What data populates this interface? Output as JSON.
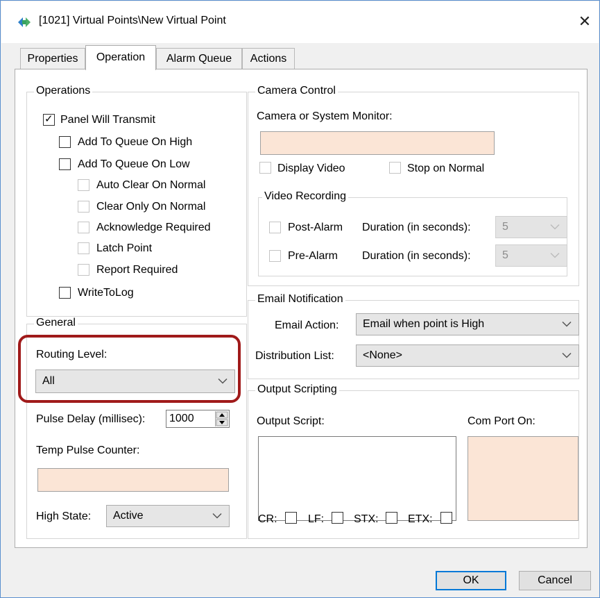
{
  "window": {
    "title": "[1021] Virtual Points\\New Virtual Point",
    "close_glyph": "✕",
    "icon": "refresh-arrows-icon"
  },
  "tabs": [
    {
      "label": "Properties",
      "active": false
    },
    {
      "label": "Operation",
      "active": true
    },
    {
      "label": "Alarm Queue",
      "active": false
    },
    {
      "label": "Actions",
      "active": false
    }
  ],
  "operations": {
    "legend": "Operations",
    "panel_will_transmit": {
      "label": "Panel Will Transmit",
      "checked": true
    },
    "add_queue_high": {
      "label": "Add To Queue On High",
      "checked": false
    },
    "add_queue_low": {
      "label": "Add To Queue On Low",
      "checked": false
    },
    "auto_clear": {
      "label": "Auto Clear On Normal",
      "checked": false,
      "enabled": false
    },
    "clear_only": {
      "label": "Clear Only On Normal",
      "checked": false,
      "enabled": false
    },
    "ack_required": {
      "label": "Acknowledge Required",
      "checked": false,
      "enabled": false
    },
    "latch_point": {
      "label": "Latch Point",
      "checked": false,
      "enabled": false
    },
    "report_required": {
      "label": "Report Required",
      "checked": false,
      "enabled": false
    },
    "write_to_log": {
      "label": "WriteToLog",
      "checked": false
    }
  },
  "general": {
    "legend": "General",
    "routing_label": "Routing Level:",
    "routing_value": "All",
    "pulse_label": "Pulse Delay (millisec):",
    "pulse_value": "1000",
    "temp_pulse_label": "Temp Pulse Counter:",
    "temp_pulse_value": "",
    "high_state_label": "High State:",
    "high_state_value": "Active"
  },
  "camera": {
    "legend": "Camera Control",
    "monitor_label": "Camera or System Monitor:",
    "monitor_value": "",
    "display_video": "Display Video",
    "stop_on_normal": "Stop on Normal",
    "recording_legend": "Video Recording",
    "post_alarm": "Post-Alarm",
    "pre_alarm": "Pre-Alarm",
    "duration_label": "Duration (in seconds):",
    "post_duration": "5",
    "pre_duration": "5"
  },
  "email": {
    "legend": "Email Notification",
    "action_label": "Email Action:",
    "action_value": "Email when point is High",
    "dist_label": "Distribution List:",
    "dist_value": "<None>"
  },
  "scripting": {
    "legend": "Output Scripting",
    "script_label": "Output Script:",
    "com_label": "Com Port On:",
    "cr": "CR:",
    "lf": "LF:",
    "stx": "STX:",
    "etx": "ETX:"
  },
  "buttons": {
    "ok": "OK",
    "cancel": "Cancel"
  },
  "colors": {
    "highlight": "#a01a1a",
    "peach_field": "#fbe5d6",
    "default_button_border": "#0078d7"
  }
}
